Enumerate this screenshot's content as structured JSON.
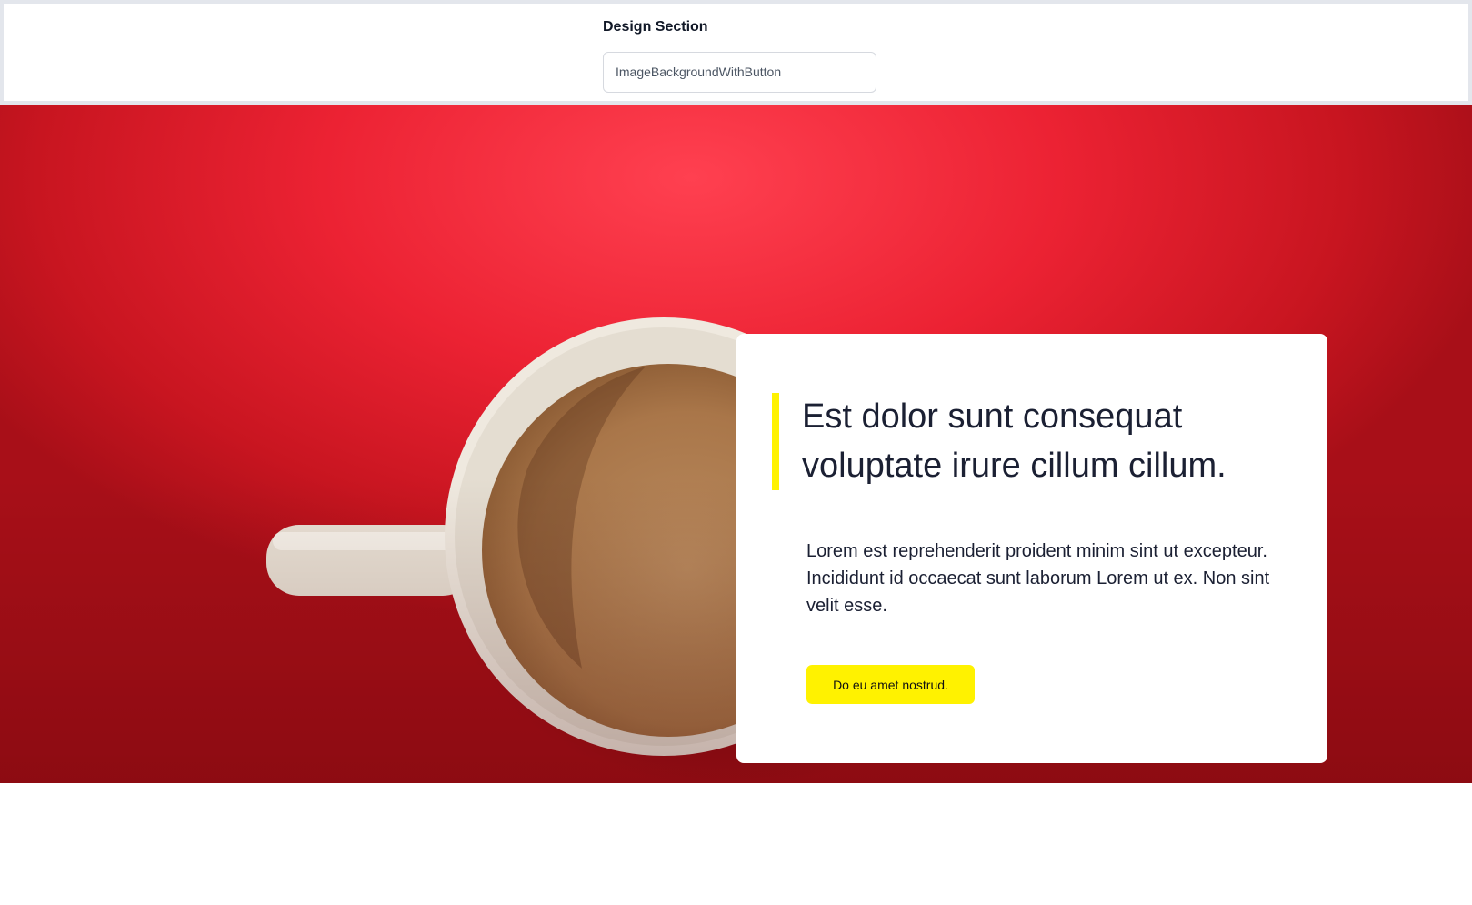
{
  "design_selector": {
    "label": "Design Section",
    "value": "ImageBackgroundWithButton"
  },
  "hero": {
    "headline": "Est dolor sunt consequat voluptate irure cillum cillum.",
    "body": "Lorem est reprehenderit proident minim sint ut excepteur. Incididunt id occaecat sunt laborum Lorem ut ex. Non sint velit esse.",
    "button_label": "Do eu amet nostrud.",
    "background_image": "coffee-mug-on-red-background"
  },
  "colors": {
    "accent": "#fff200",
    "background": "#ec2233",
    "text": "#1b2033"
  }
}
